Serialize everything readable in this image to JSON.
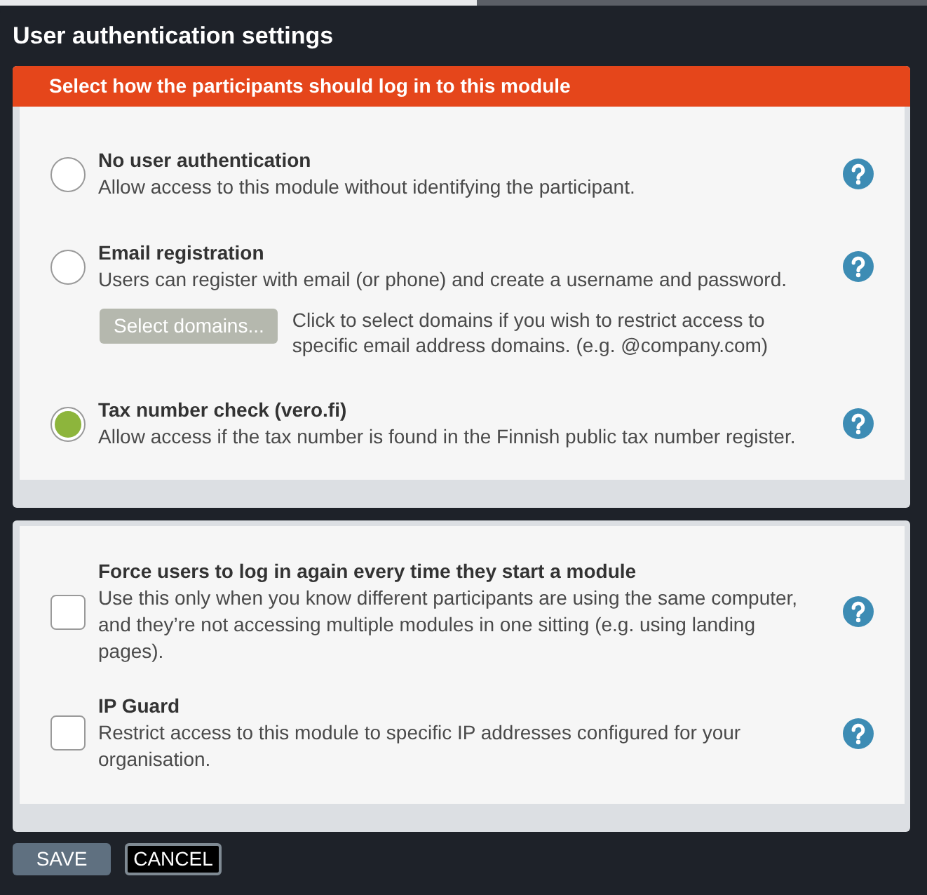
{
  "dialog": {
    "title": "User authentication settings"
  },
  "login": {
    "header": "Select how the participants should log in to this module",
    "options": [
      {
        "title": "No user authentication",
        "description": "Allow access to this module without identifying the participant.",
        "selected": false
      },
      {
        "title": "Email registration",
        "description": "Users can register with email (or phone) and create a username and password.",
        "selected": false,
        "domains": {
          "button": "Select domains...",
          "disabled": true,
          "hint": "Click to select domains if you wish to restrict access to specific email address domains. (e.g. @company.com)"
        }
      },
      {
        "title": "Tax number check (vero.fi)",
        "description": "Allow access if the tax number is found in the Finnish public tax number register.",
        "selected": true
      }
    ]
  },
  "settings": [
    {
      "title": "Force users to log in again every time they start a module",
      "description": "Use this only when you know different participants are using the same computer, and they’re not accessing multiple modules in one sitting (e.g. using landing pages).",
      "checked": false
    },
    {
      "title": "IP Guard",
      "description": "Restrict access to this module to specific IP addresses configured for your organisation.",
      "checked": false
    }
  ],
  "buttons": [
    {
      "label": "SAVE",
      "kind": "primary"
    },
    {
      "label": "CANCEL",
      "kind": "secondary"
    }
  ]
}
